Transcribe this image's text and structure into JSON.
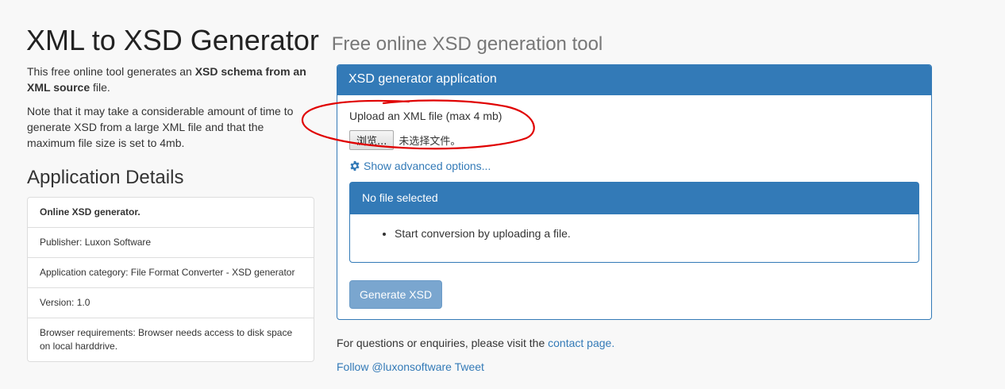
{
  "header": {
    "title": "XML to XSD Generator",
    "subtitle": "Free online XSD generation tool"
  },
  "intro": {
    "p1_prefix": "This free online tool generates an ",
    "p1_bold": "XSD schema from an XML source",
    "p1_suffix": " file.",
    "p2": "Note that it may take a considerable amount of time to generate XSD from a large XML file and that the maximum file size is set to 4mb."
  },
  "details": {
    "heading": "Application Details",
    "items": [
      "Online XSD generator.",
      "Publisher: Luxon Software",
      "Application category: File Format Converter - XSD generator",
      "Version: 1.0",
      "Browser requirements: Browser needs access to disk space on local harddrive."
    ]
  },
  "panel": {
    "heading": "XSD generator application",
    "upload_label": "Upload an XML file (max 4 mb)",
    "browse_label": "浏览...",
    "file_status": "未选择文件。",
    "advanced_label": "Show advanced options...",
    "advanced_icon": "gear-icon",
    "status_heading": "No file selected",
    "status_item": "Start conversion by uploading a file.",
    "generate_label": "Generate XSD"
  },
  "footer": {
    "questions_prefix": "For questions or enquiries, please visit the ",
    "contact_link": "contact page.",
    "follow": "Follow @luxonsoftware",
    "tweet": "Tweet"
  },
  "colors": {
    "primary": "#337ab7",
    "annotation": "#e00000",
    "background": "#f8f8f8"
  }
}
